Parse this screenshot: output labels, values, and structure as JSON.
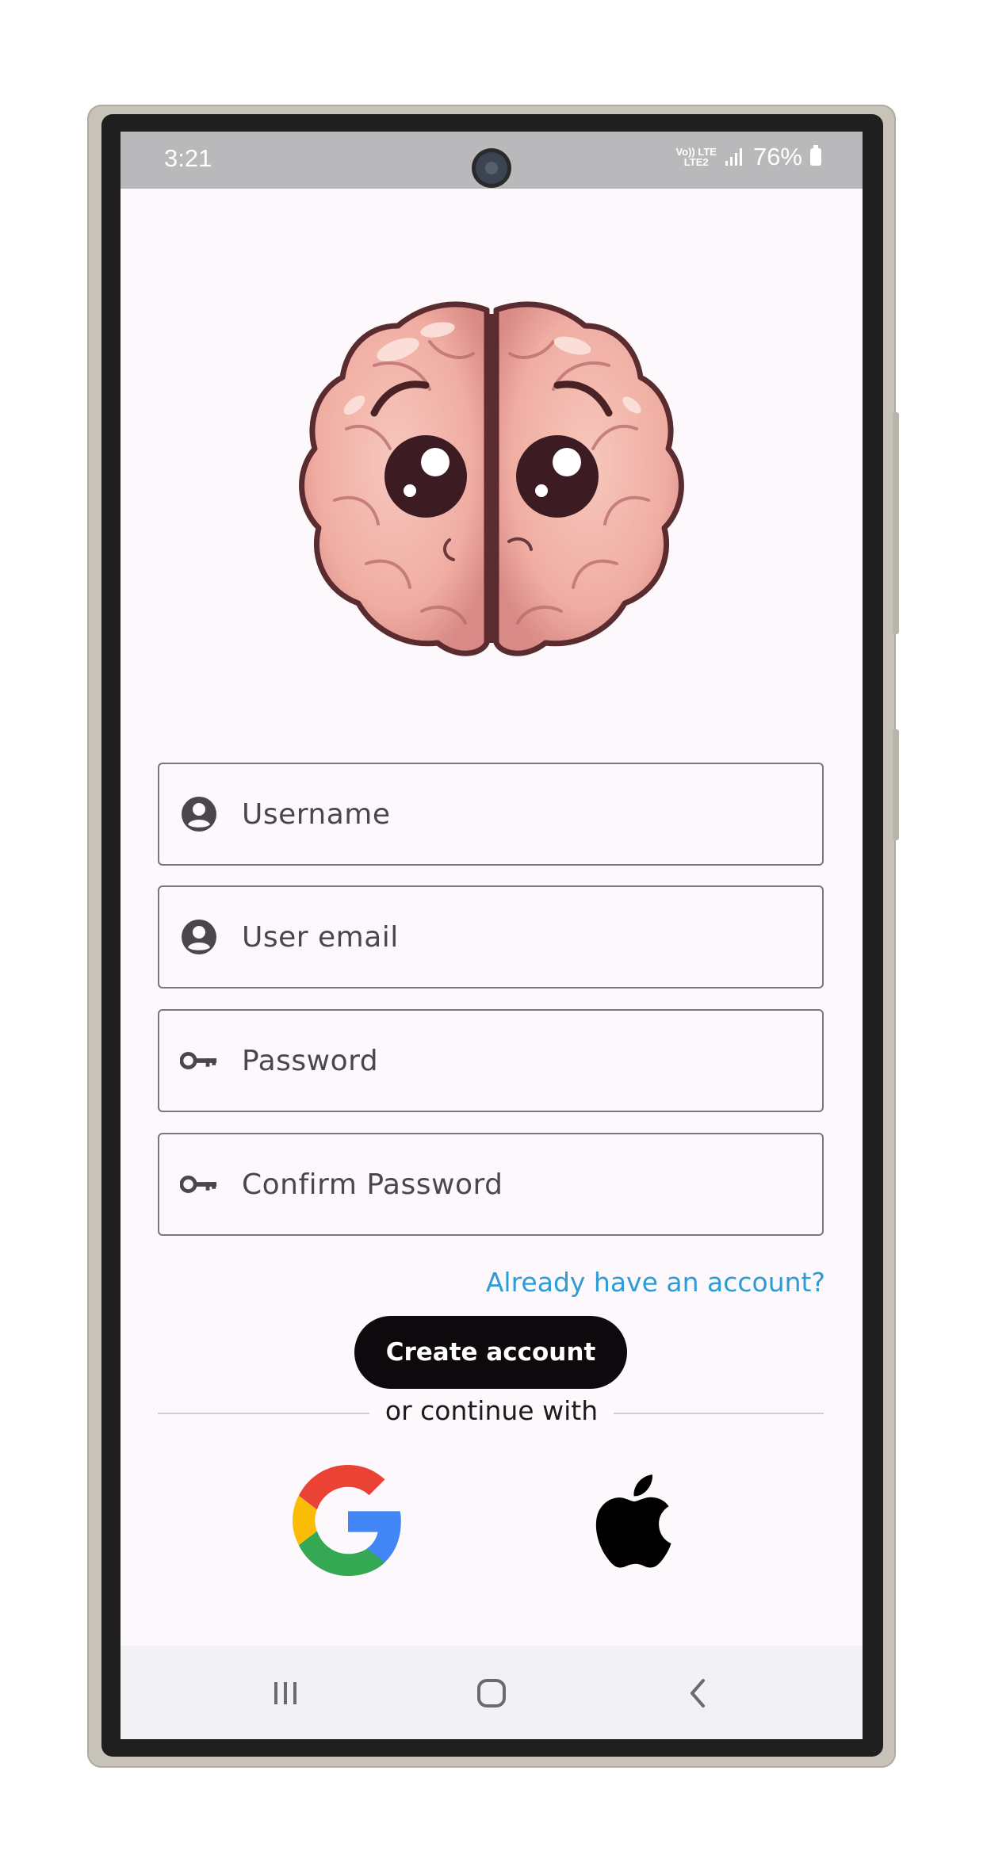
{
  "status_bar": {
    "time": "3:21",
    "network_top": "Vo)) LTE",
    "network_bottom": "LTE2",
    "battery": "76%"
  },
  "form": {
    "username_placeholder": "Username",
    "email_placeholder": "User email",
    "password_placeholder": "Password",
    "confirm_password_placeholder": "Confirm Password",
    "login_link": "Already have an account?",
    "create_button": "Create account",
    "divider_text": "or continue with"
  },
  "social": {
    "google_icon": "google-icon",
    "apple_icon": "apple-icon"
  },
  "icons": {
    "user": "account-circle-icon",
    "key": "key-icon"
  },
  "colors": {
    "link": "#2d9bd6",
    "button": "#0e090d",
    "screen_bg": "#fdf8fb"
  }
}
